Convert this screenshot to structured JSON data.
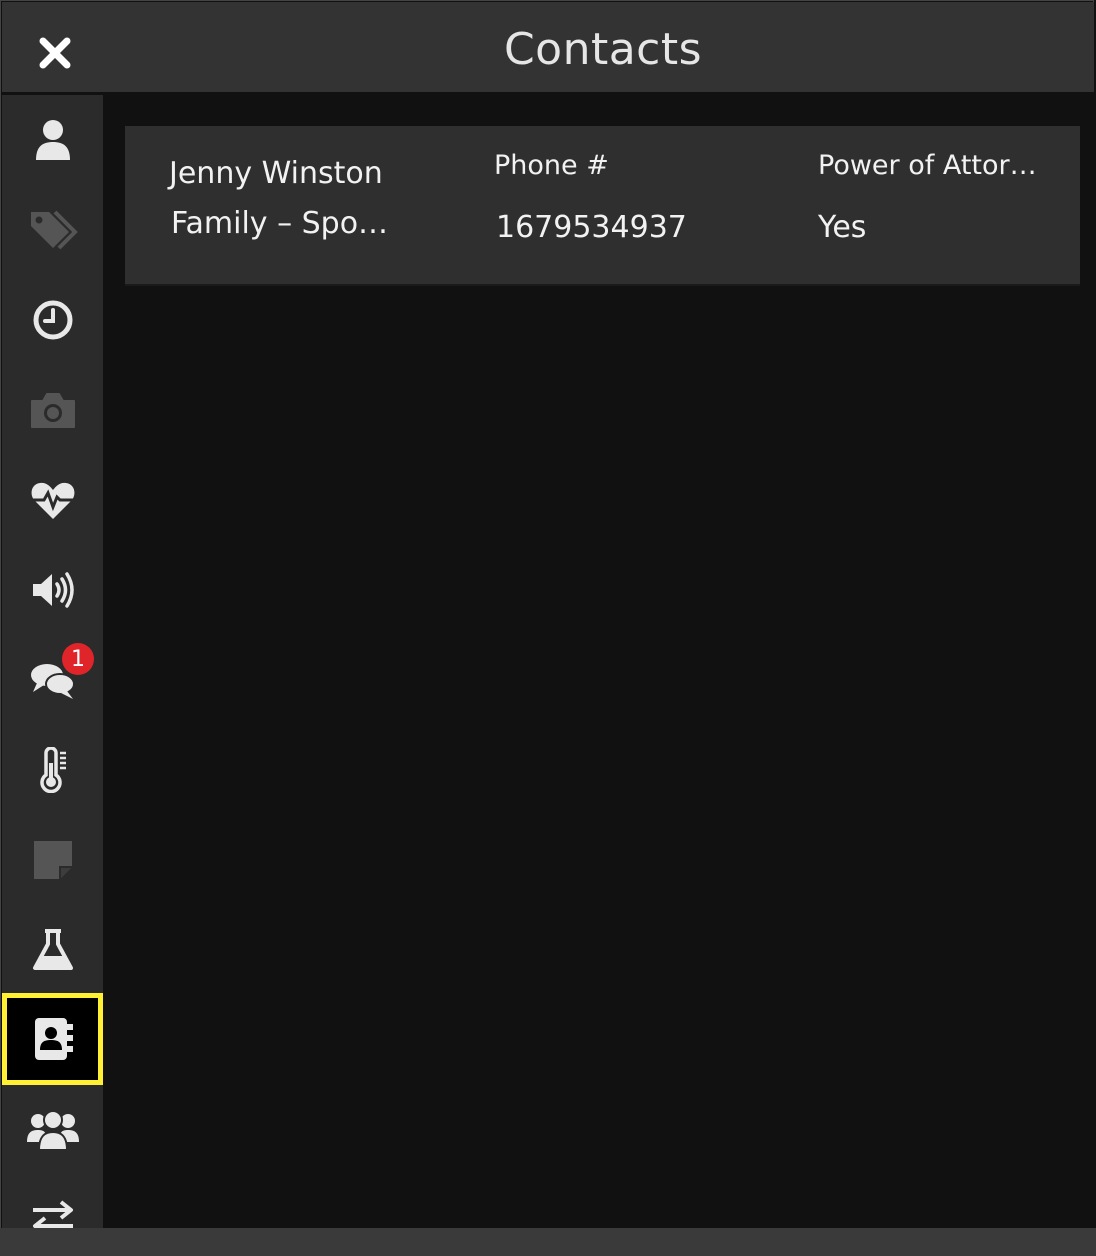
{
  "header": {
    "title": "Contacts",
    "close_icon": "close-icon"
  },
  "sidebar": {
    "items": [
      {
        "name": "user",
        "icon": "user-icon",
        "active": false
      },
      {
        "name": "tags",
        "icon": "tags-icon",
        "active": false
      },
      {
        "name": "history",
        "icon": "clock-icon",
        "active": false
      },
      {
        "name": "photos",
        "icon": "camera-icon",
        "active": false
      },
      {
        "name": "vitals",
        "icon": "heartbeat-icon",
        "active": false
      },
      {
        "name": "audio",
        "icon": "speaker-icon",
        "active": false
      },
      {
        "name": "messages",
        "icon": "chat-icon",
        "active": false,
        "badge": "1"
      },
      {
        "name": "temperature",
        "icon": "thermometer-icon",
        "active": false
      },
      {
        "name": "notes",
        "icon": "note-icon",
        "active": false
      },
      {
        "name": "labs",
        "icon": "flask-icon",
        "active": false
      },
      {
        "name": "contacts",
        "icon": "address-book-icon",
        "active": true
      },
      {
        "name": "group",
        "icon": "users-icon",
        "active": false
      },
      {
        "name": "transfer",
        "icon": "exchange-icon",
        "active": false
      }
    ]
  },
  "contacts": [
    {
      "name": "Jenny Winston",
      "relationship": "Family – Spo…",
      "phone_header": "Phone #",
      "phone": "1679534937",
      "poa_header": "Power of Attor…",
      "poa": "Yes"
    }
  ],
  "colors": {
    "header_bg": "#333333",
    "sidebar_bg": "#2b2b2b",
    "content_bg": "#111111",
    "card_bg": "#2f2f2f",
    "active_highlight": "#fff033",
    "badge": "#e0252a"
  }
}
